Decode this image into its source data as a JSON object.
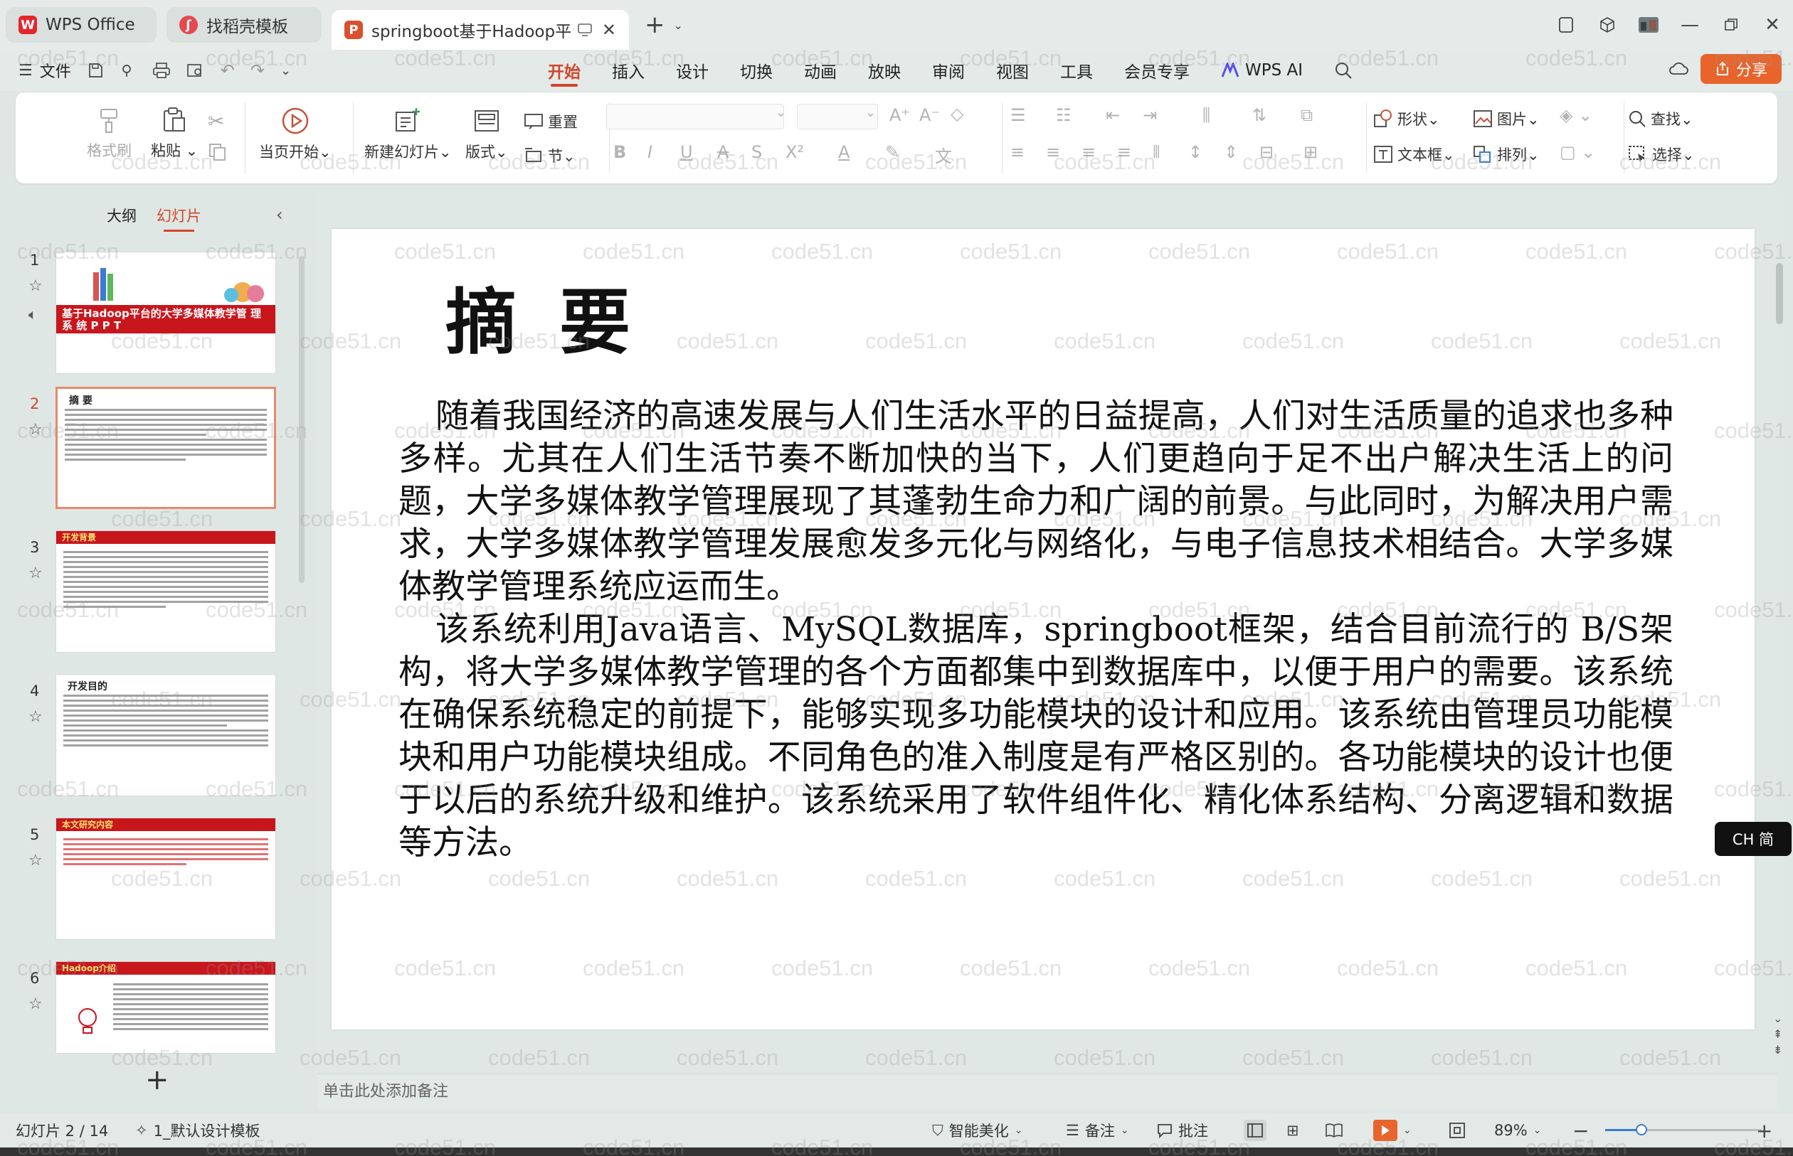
{
  "tabs": {
    "wps": "WPS Office",
    "daoke": "找稻壳模板",
    "doc": "springboot基于Hadoop平台的"
  },
  "menu": {
    "file": "文件",
    "tabs": [
      "开始",
      "插入",
      "设计",
      "切换",
      "动画",
      "放映",
      "审阅",
      "视图",
      "工具",
      "会员专享"
    ],
    "active": "开始",
    "wps_ai": "WPS AI",
    "share": "分享"
  },
  "ribbon": {
    "format_painter": "格式刷",
    "paste": "粘贴",
    "from_current": "当页开始",
    "new_slide": "新建幻灯片",
    "layout": "版式",
    "reset": "重置",
    "section": "节",
    "shape": "形状",
    "picture": "图片",
    "find": "查找",
    "textbox": "文本框",
    "arrange": "排列",
    "select": "选择"
  },
  "panel": {
    "outline_tab": "大纲",
    "slides_tab": "幻灯片"
  },
  "thumbnails": [
    {
      "num": "1",
      "title": "基于Hadoop平台的大学多媒体教学管 理 系 统 P P T"
    },
    {
      "num": "2",
      "title": "摘 要"
    },
    {
      "num": "3",
      "title": "开发背景"
    },
    {
      "num": "4",
      "title": "开发目的"
    },
    {
      "num": "5",
      "title": "本文研究内容"
    },
    {
      "num": "6",
      "title": "Hadoop介绍"
    }
  ],
  "slide": {
    "title": "摘要",
    "para1": "随着我国经济的高速发展与人们生活水平的日益提高，人们对生活质量的追求也多种多样。尤其在人们生活节奏不断加快的当下，人们更趋向于足不出户解决生活上的问题，大学多媒体教学管理展现了其蓬勃生命力和广阔的前景。与此同时，为解决用户需求，大学多媒体教学管理发展愈发多元化与网络化，与电子信息技术相结合。大学多媒体教学管理系统应运而生。",
    "para2": "该系统利用Java语言、MySQL数据库，springboot框架，结合目前流行的 B/S架构，将大学多媒体教学管理的各个方面都集中到数据库中，以便于用户的需要。该系统在确保系统稳定的前提下，能够实现多功能模块的设计和应用。该系统由管理员功能模块和用户功能模块组成。不同角色的准入制度是有严格区别的。各功能模块的设计也便于以后的系统升级和维护。该系统采用了软件组件化、精化体系结构、分离逻辑和数据等方法。"
  },
  "notes_placeholder": "单击此处添加备注",
  "ime": "CH 简",
  "status": {
    "slide_counter": "幻灯片 2 / 14",
    "template": "1_默认设计模板",
    "beautify": "智能美化",
    "notes": "备注",
    "comments": "批注",
    "zoom": "89%",
    "zoom_fraction": 0.23
  },
  "watermark": "code51.cn",
  "colors": {
    "accent": "#d4452b",
    "share": "#e8642c",
    "slide_red": "#c8161d"
  }
}
